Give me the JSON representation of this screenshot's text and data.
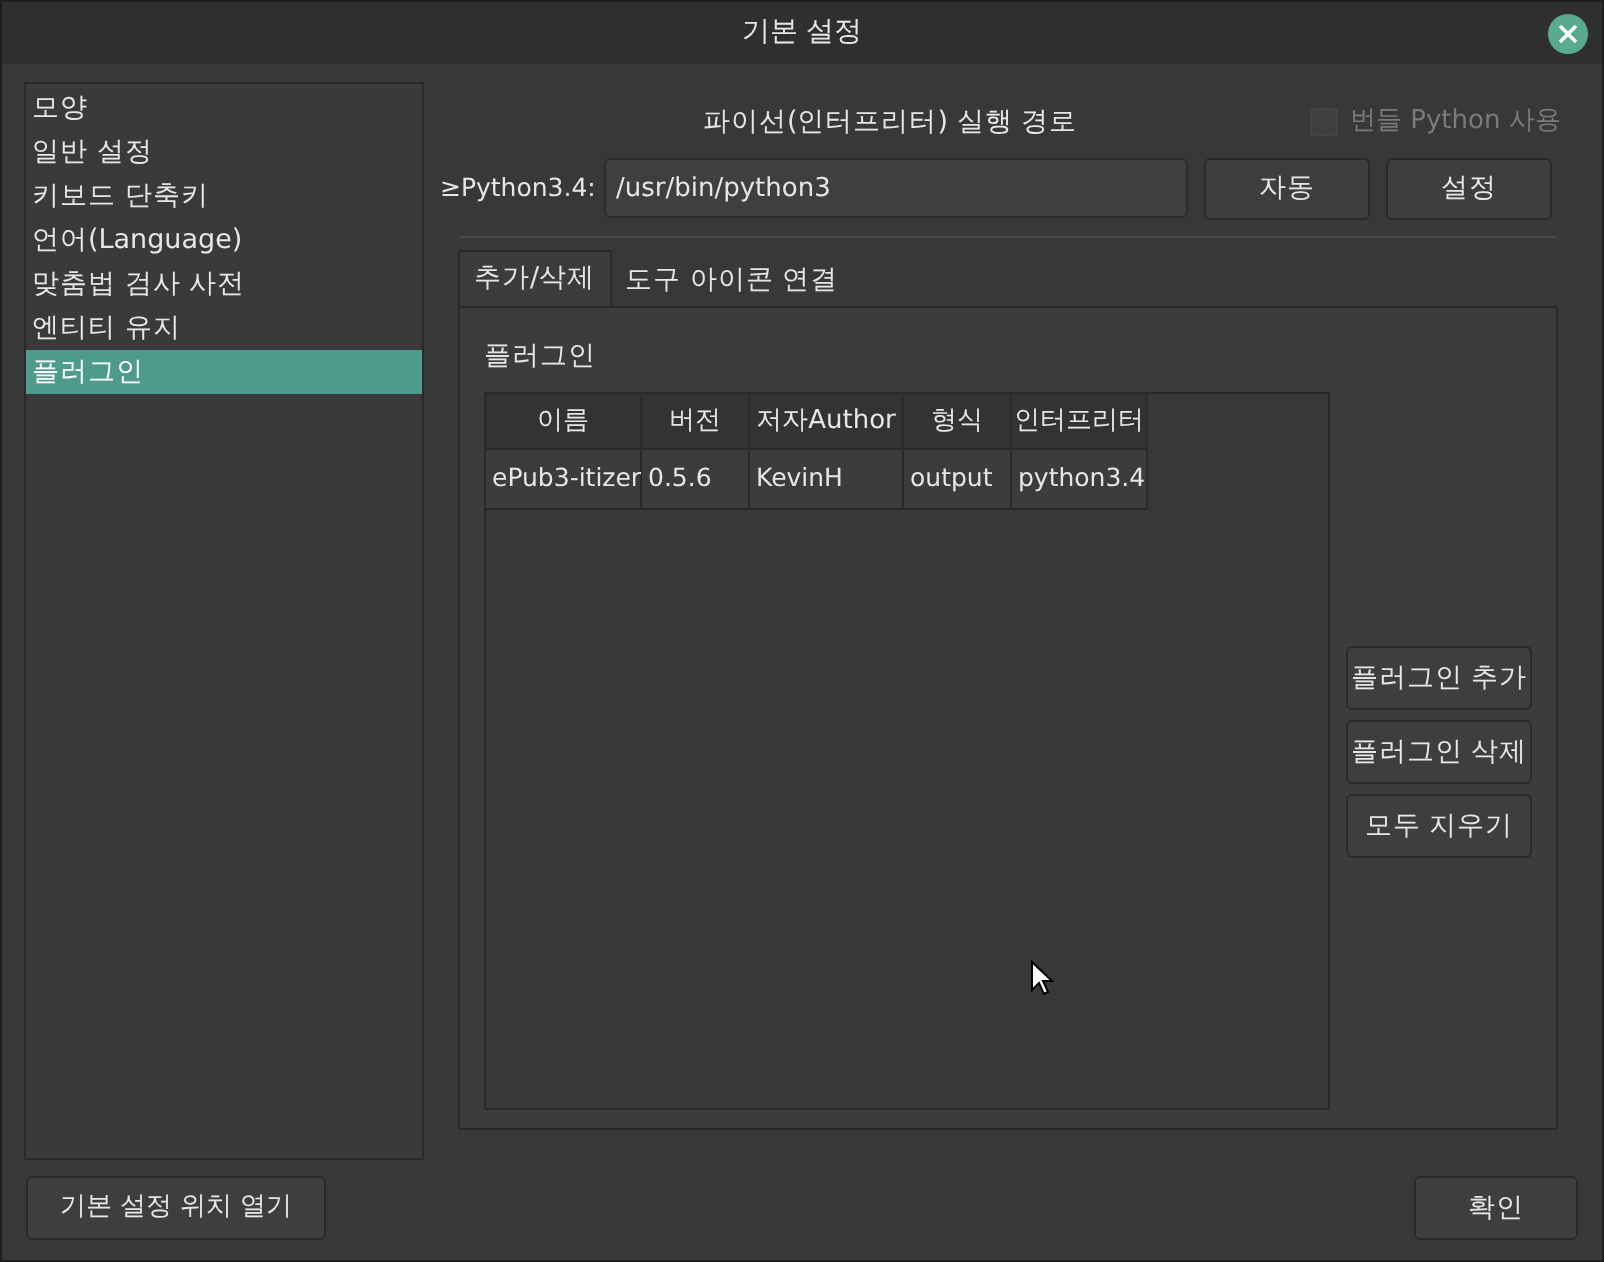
{
  "window": {
    "title": "기본 설정"
  },
  "sidebar": {
    "items": [
      {
        "label": "모양",
        "selected": false
      },
      {
        "label": "일반 설정",
        "selected": false
      },
      {
        "label": "키보드 단축키",
        "selected": false
      },
      {
        "label": "언어(Language)",
        "selected": false
      },
      {
        "label": "맞춤법 검사 사전",
        "selected": false
      },
      {
        "label": "엔티티 유지",
        "selected": false
      },
      {
        "label": "플러그인",
        "selected": true
      }
    ]
  },
  "python": {
    "heading": "파이선(인터프리터) 실행 경로",
    "bundled": {
      "label": "번들 Python 사용",
      "checked": false,
      "disabled": true
    },
    "path_label": "≥Python3.4:",
    "path_value": "/usr/bin/python3",
    "buttons": [
      "자동",
      "설정"
    ]
  },
  "tabs": [
    {
      "label": "추가/삭제",
      "selected": true
    },
    {
      "label": "도구 아이콘 연결",
      "selected": false
    }
  ],
  "plugins": {
    "heading": "플러그인",
    "table": {
      "columns": [
        "이름",
        "버전",
        "저자Author",
        "형식",
        "인터프리터"
      ],
      "rows": [
        [
          "ePub3-itizer",
          "0.5.6",
          "KevinH",
          "output",
          "python3.4"
        ]
      ]
    },
    "buttons": [
      "플러그인 추가",
      "플러그인 삭제",
      "모두 지우기"
    ]
  },
  "footer": {
    "left_button": "기본 설정 위치 열기",
    "ok_button": "확인"
  }
}
